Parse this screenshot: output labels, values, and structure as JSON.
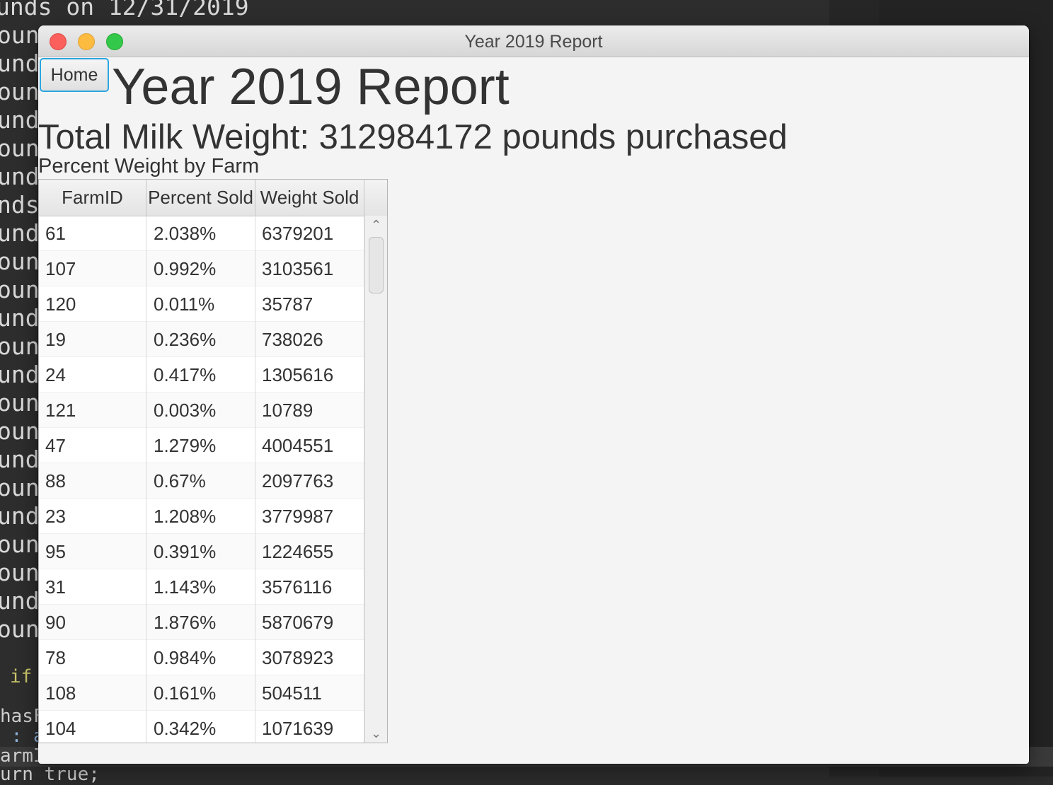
{
  "background": {
    "top_line": "unds on 12/31/2019",
    "side_fragments": [
      "oun",
      "und",
      "oun",
      "und",
      "oun",
      "und",
      "nds",
      "und",
      "oun",
      "oun",
      "und",
      "oun",
      "und",
      "oun",
      "oun",
      "und",
      "oun",
      "und",
      "oun",
      "oun",
      "und",
      "oun"
    ],
    "snippet_if": "if",
    "snippet_hasF": "hasF",
    "snippet_colon_a": " : a",
    "snippet_armI": "armI",
    "snippet_return": "urn true;"
  },
  "window": {
    "title": "Year 2019 Report"
  },
  "home_button": {
    "label": "Home"
  },
  "page": {
    "title": "Year 2019 Report",
    "total_weight_text": "Total Milk Weight: 312984172 pounds purchased",
    "table_caption": "Percent Weight by Farm"
  },
  "table": {
    "columns": [
      "FarmID",
      "Percent Sold",
      "Weight Sold"
    ],
    "rows": [
      [
        "61",
        "2.038%",
        "6379201"
      ],
      [
        "107",
        "0.992%",
        "3103561"
      ],
      [
        "120",
        "0.011%",
        "35787"
      ],
      [
        "19",
        "0.236%",
        "738026"
      ],
      [
        "24",
        "0.417%",
        "1305616"
      ],
      [
        "121",
        "0.003%",
        "10789"
      ],
      [
        "47",
        "1.279%",
        "4004551"
      ],
      [
        "88",
        "0.67%",
        "2097763"
      ],
      [
        "23",
        "1.208%",
        "3779987"
      ],
      [
        "95",
        "0.391%",
        "1224655"
      ],
      [
        "31",
        "1.143%",
        "3576116"
      ],
      [
        "90",
        "1.876%",
        "5870679"
      ],
      [
        "78",
        "0.984%",
        "3078923"
      ],
      [
        "108",
        "0.161%",
        "504511"
      ],
      [
        "104",
        "0.342%",
        "1071639"
      ]
    ],
    "scroll_up_glyph": "⌃",
    "scroll_down_glyph": "⌄"
  }
}
